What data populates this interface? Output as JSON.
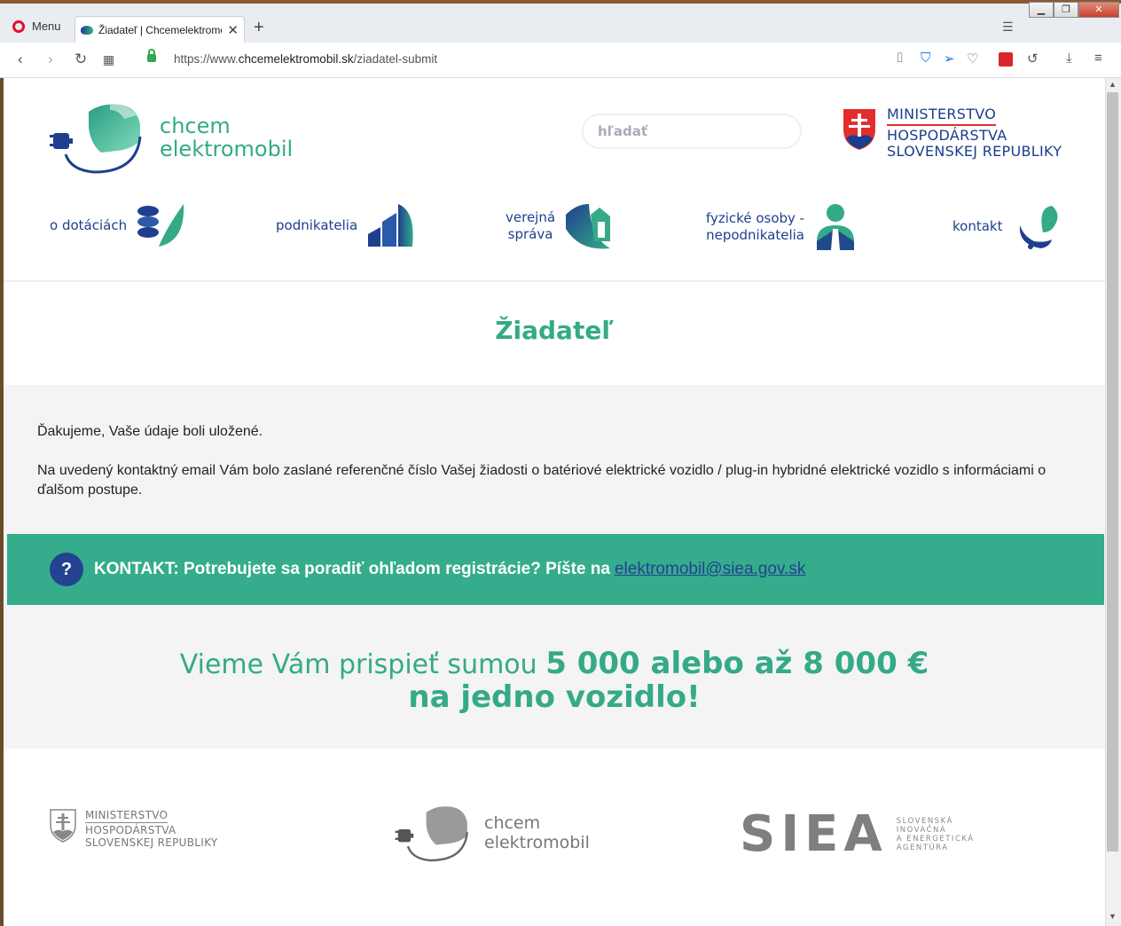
{
  "browser": {
    "menu_label": "Menu",
    "tab_title": "Žiadateľ | Chcemelektromo",
    "url_prefix": "https://www.",
    "url_host": "chcemelektromobil.sk",
    "url_path": "/ziadatel-submit"
  },
  "header": {
    "logo_line1": "chcem",
    "logo_line2": "elektromobil",
    "search_placeholder": "hľadať",
    "ministry_line1": "MINISTERSTVO",
    "ministry_line2": "HOSPODÁRSTVA",
    "ministry_line3": "SLOVENSKEJ REPUBLIKY"
  },
  "nav": {
    "items": [
      {
        "line1": "o dotáciách",
        "line2": ""
      },
      {
        "line1": "podnikatelia",
        "line2": ""
      },
      {
        "line1": "verejná",
        "line2": "správa"
      },
      {
        "line1": "fyzické osoby -",
        "line2": "nepodnikatelia"
      },
      {
        "line1": "kontakt",
        "line2": ""
      }
    ]
  },
  "main": {
    "title": "Žiadateľ",
    "thanks": "Ďakujeme, Vaše údaje boli uložené.",
    "info": "Na uvedený kontaktný email Vám bolo zaslané referenčné číslo Vašej žiadosti o batériové elektrické vozidlo / plug-in hybridné elektrické vozidlo s informáciami o ďalšom postupe."
  },
  "contact": {
    "icon": "?",
    "text": "KONTAKT: Potrebujete sa poradiť ohľadom registrácie? Píšte na",
    "email": "elektromobil@siea.gov.sk"
  },
  "promo": {
    "light": "Vieme Vám prispieť sumou",
    "strong": "5 000 alebo až 8 000 €",
    "line2": "na jedno vozidlo!"
  },
  "footer": {
    "ministry_line1": "MINISTERSTVO",
    "ministry_line2": "HOSPODÁRSTVA",
    "ministry_line3": "SLOVENSKEJ REPUBLIKY",
    "logo_line1": "chcem",
    "logo_line2": "elektromobil",
    "siea": "SIEA",
    "siea_sub1": "SLOVENSKÁ",
    "siea_sub2": "INOVAČNÁ",
    "siea_sub3": "A ENERGETICKÁ",
    "siea_sub4": "AGENTÚRA"
  },
  "colors": {
    "brand_green": "#34aa87",
    "brand_blue": "#1f3f8e",
    "contact_bar": "#35ac8c"
  }
}
